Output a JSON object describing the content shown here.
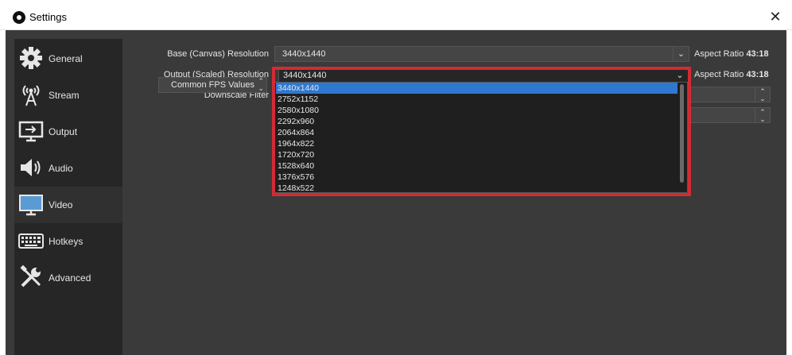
{
  "window": {
    "title": "Settings"
  },
  "sidebar": {
    "items": [
      {
        "label": "General",
        "icon": "gear-icon"
      },
      {
        "label": "Stream",
        "icon": "broadcast-antenna-icon"
      },
      {
        "label": "Output",
        "icon": "output-monitor-icon"
      },
      {
        "label": "Audio",
        "icon": "speaker-icon"
      },
      {
        "label": "Video",
        "icon": "monitor-icon",
        "active": true
      },
      {
        "label": "Hotkeys",
        "icon": "keyboard-icon"
      },
      {
        "label": "Advanced",
        "icon": "tools-icon"
      }
    ]
  },
  "video": {
    "base_label": "Base (Canvas) Resolution",
    "base_value": "3440x1440",
    "base_aspect_label": "Aspect Ratio",
    "base_aspect_value": "43:18",
    "output_label": "Output (Scaled) Resolution",
    "output_value": "3440x1440",
    "output_aspect_label": "Aspect Ratio",
    "output_aspect_value": "43:18",
    "downscale_label": "Downscale Filter",
    "fps_label": "Common FPS Values"
  },
  "dropdown": {
    "options": [
      "3440x1440",
      "2752x1152",
      "2580x1080",
      "2292x960",
      "2064x864",
      "1964x822",
      "1720x720",
      "1528x640",
      "1376x576",
      "1248x522"
    ],
    "selected": "3440x1440"
  },
  "colors": {
    "highlight": "#d22b35",
    "selection": "#2f78d1",
    "background": "#3a3a3a",
    "sidebar": "#262626"
  }
}
